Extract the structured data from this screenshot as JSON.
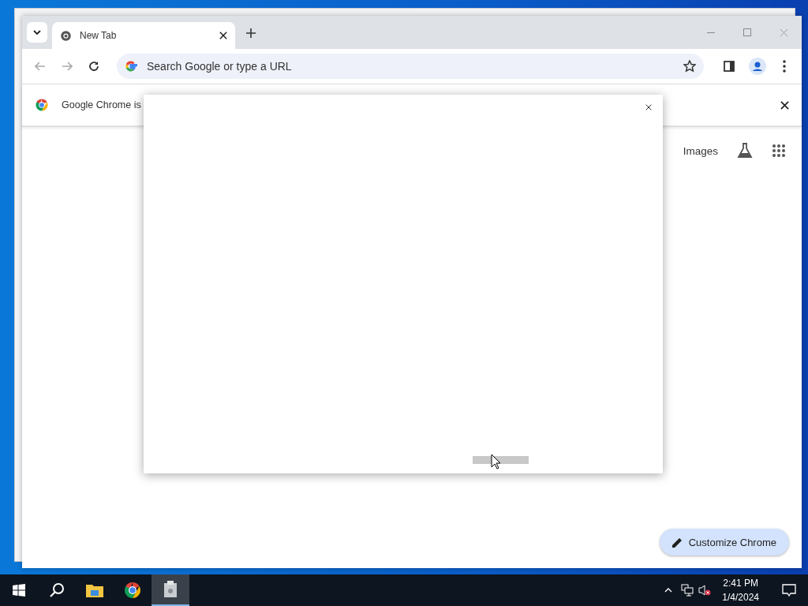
{
  "browser": {
    "tabs": [
      {
        "title": "New Tab",
        "selected": true
      }
    ],
    "address_bar": {
      "placeholder": "Search Google or type a URL"
    },
    "infobar": {
      "message": "Google Chrome is"
    },
    "header_links": [
      "Images"
    ],
    "customize_button": "Customize Chrome"
  },
  "dialog": {
    "button": {
      "disabled": true
    }
  },
  "taskbar": {
    "apps": [
      {
        "kind": "explorer",
        "selected": false
      },
      {
        "kind": "chrome",
        "selected": false
      },
      {
        "kind": "app",
        "selected": true
      }
    ],
    "clock": {
      "time": "2:41 PM",
      "date": "1/4/2024"
    }
  }
}
